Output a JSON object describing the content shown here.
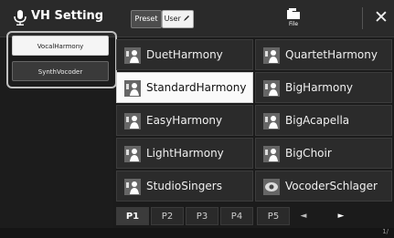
{
  "header": {
    "title": "VH Setting",
    "preset_label": "Preset",
    "user_label": "User",
    "file_label": "File",
    "close_label": "✕"
  },
  "sidebar": {
    "items": [
      {
        "label": "VocalHarmony",
        "selected": true
      },
      {
        "label": "SynthVocoder",
        "selected": false
      }
    ]
  },
  "grid": {
    "items": [
      {
        "label": "DuetHarmony"
      },
      {
        "label": "QuartetHarmony"
      },
      {
        "label": "StandardHarmony",
        "selected": true
      },
      {
        "label": "BigHarmony"
      },
      {
        "label": "EasyHarmony"
      },
      {
        "label": "BigAcapella"
      },
      {
        "label": "LightHarmony"
      },
      {
        "label": "BigChoir"
      },
      {
        "label": "StudioSingers"
      },
      {
        "label": "VocoderSchlager"
      }
    ]
  },
  "pager": {
    "pages": [
      "P1",
      "P2",
      "P3",
      "P4",
      "P5"
    ],
    "active": "P1",
    "prev": "◄",
    "next": "►",
    "page_count": "1/"
  },
  "colors": {
    "background": "#1b1b1b",
    "selected_bg": "#fafafa",
    "cell_bg": "#2b2b2b",
    "text": "#f0f0f0"
  }
}
